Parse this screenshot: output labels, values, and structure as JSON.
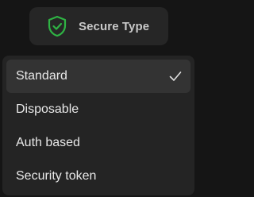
{
  "trigger": {
    "label": "Secure Type",
    "icon": "shield-check-icon",
    "icon_color": "#2fb344"
  },
  "dropdown": {
    "options": [
      {
        "label": "Standard",
        "selected": true
      },
      {
        "label": "Disposable",
        "selected": false
      },
      {
        "label": "Auth based",
        "selected": false
      },
      {
        "label": "Security token",
        "selected": false
      }
    ],
    "selected_icon": "checkmark-icon"
  }
}
